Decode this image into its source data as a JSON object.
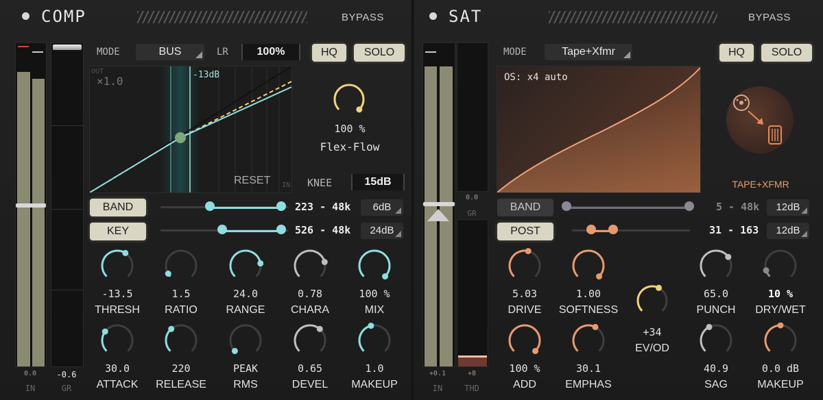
{
  "comp": {
    "title": "COMP",
    "bypass": "BYPASS",
    "mode_label": "MODE",
    "mode_value": "BUS",
    "lr_label": "LR",
    "lr_value": "100%",
    "hq": "HQ",
    "solo": "SOLO",
    "graph_out": "OUT",
    "graph_scale": "×1.0",
    "graph_thresh": "-13dB",
    "graph_in": "IN",
    "reset": "RESET",
    "flex_value": "100 %",
    "flex_label": "Flex-Flow",
    "flex_level": 1.0,
    "knee_label": "KNEE",
    "knee_value": "15dB",
    "band_button": "BAND",
    "band_range": "223 - 48k",
    "band_slope": "6dB",
    "key_button": "KEY",
    "key_range": "526 - 48k",
    "key_slope": "24dB",
    "meter_in_value": "0.0",
    "meter_in_label": "IN",
    "meter_gr_value": "-0.6",
    "meter_gr_label": "GR",
    "knobs_row1": [
      {
        "value": "-13.5",
        "label": "THRESH",
        "level": 0.62
      },
      {
        "value": "1.5",
        "label": "RATIO",
        "level": 0.05
      },
      {
        "value": "24.0",
        "label": "RANGE",
        "level": 0.8
      },
      {
        "value": "0.78",
        "label": "CHARA",
        "level": 0.78
      },
      {
        "value": "100 %",
        "label": "MIX",
        "level": 1.0
      }
    ],
    "knobs_row2": [
      {
        "value": "30.0",
        "label": "ATTACK",
        "level": 0.3
      },
      {
        "value": "220",
        "label": "RELEASE",
        "level": 0.35
      },
      {
        "value": "PEAK",
        "label": "RMS",
        "level": 0.0
      },
      {
        "value": "0.65",
        "label": "DEVEL",
        "level": 0.65
      },
      {
        "value": "1.0",
        "label": "MAKEUP",
        "level": 0.45
      }
    ]
  },
  "sat": {
    "title": "SAT",
    "bypass": "BYPASS",
    "mode_label": "MODE",
    "mode_value": "Tape+Xfmr",
    "hq": "HQ",
    "solo": "SOLO",
    "os_label": "OS: x4 auto",
    "type_label": "TAPE+XFMR",
    "band_button": "BAND",
    "band_range": "5 - 48k",
    "band_slope": "12dB",
    "post_button": "POST",
    "post_range": "31 - 163",
    "post_slope": "12dB",
    "meter_in_value": "+0.1",
    "meter_in_label": "IN",
    "meter_gr_value": "0.0",
    "meter_gr_label": "GR",
    "meter_thd_value": "+8",
    "meter_thd_label": "THD",
    "ev_value": "+34",
    "ev_label": "EV/OD",
    "ev_level": 0.6,
    "knobs_row1": [
      {
        "value": "5.03",
        "label": "DRIVE",
        "level": 0.55
      },
      {
        "value": "1.00",
        "label": "SOFTNESS",
        "level": 1.0
      },
      {
        "value": "65.0",
        "label": "PUNCH",
        "level": 0.7
      },
      {
        "value": "10 %",
        "label": "DRY/WET",
        "level": 0.1
      }
    ],
    "knobs_row2": [
      {
        "value": "100 %",
        "label": "ADD",
        "level": 1.0
      },
      {
        "value": "30.1",
        "label": "EMPHAS",
        "level": 0.6
      },
      {
        "value": "40.9",
        "label": "SAG",
        "level": 0.4
      },
      {
        "value": "0.0 dB",
        "label": "MAKEUP",
        "level": 0.5
      }
    ]
  },
  "colors": {
    "comp_accent": "#8fdde0",
    "sat_accent": "#e89a6e",
    "flex_accent": "#f0d27a"
  }
}
